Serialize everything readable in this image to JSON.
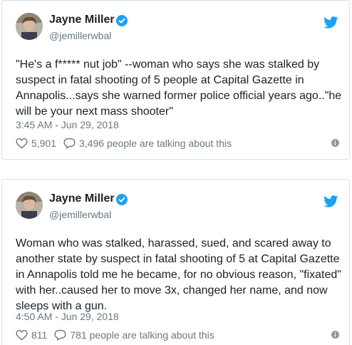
{
  "tweets": [
    {
      "author_name": "Jayne Miller",
      "handle": "@jemillerwbal",
      "text": "\"He's a f***** nut job\" --woman who says she was stalked by suspect in fatal shooting of 5 people at Capital Gazette in Annapolis...says she warned former police official years ago..\"he will be your next mass shooter\"",
      "timestamp": "3:45 AM - Jun 29, 2018",
      "likes": "5,901",
      "talking": "3,496 people are talking about this"
    },
    {
      "author_name": "Jayne Miller",
      "handle": "@jemillerwbal",
      "text": "Woman who was stalked, harassed, sued, and scared away to another state by suspect in fatal shooting of 5 at Capital Gazette in Annapolis told me he became, for no obvious reason, \"fixated\" with her..caused her to move 3x, changed her name, and now sleeps with a gun.",
      "timestamp": "4:50 AM - Jun 29, 2018",
      "likes": "811",
      "talking": "781 people are talking about this"
    }
  ],
  "icons": {
    "verified": "verified-badge-icon",
    "brand": "twitter-bird-icon",
    "like": "heart-icon",
    "reply": "reply-bubble-icon",
    "info": "info-icon"
  },
  "colors": {
    "brand": "#1da1f2",
    "text": "#1c2022",
    "secondary": "#697882",
    "border": "#d8e2e8"
  }
}
